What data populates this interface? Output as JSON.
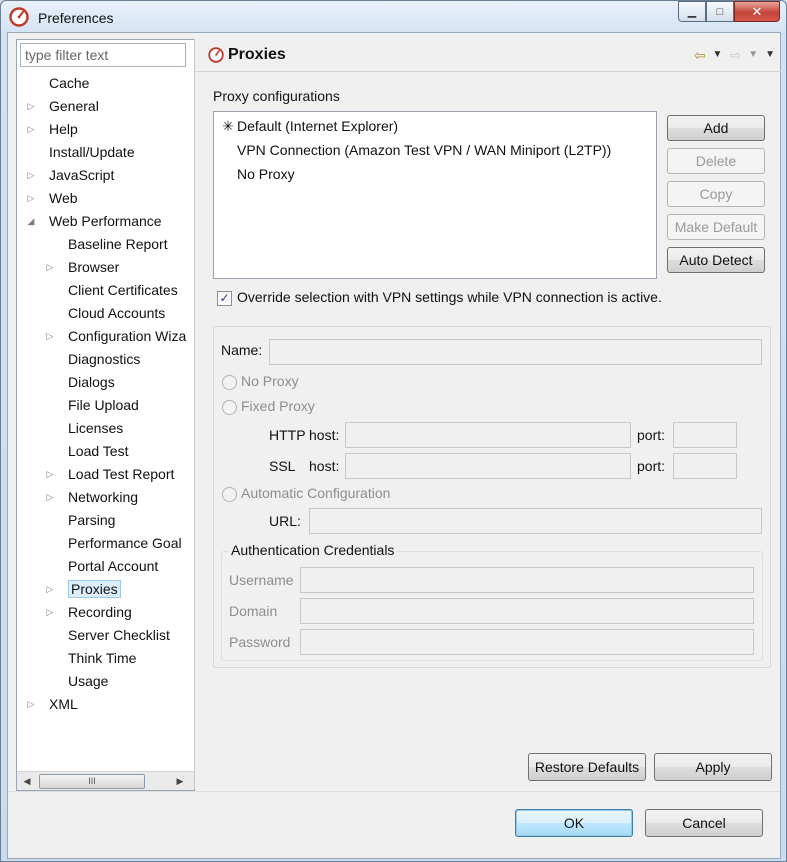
{
  "window": {
    "title": "Preferences",
    "min_glyph": "▁",
    "max_glyph": "□",
    "close_glyph": "✕"
  },
  "filter": {
    "placeholder": "type filter text"
  },
  "tree": [
    {
      "label": "Cache",
      "depth": 0,
      "arrow": ""
    },
    {
      "label": "General",
      "depth": 0,
      "arrow": "▷"
    },
    {
      "label": "Help",
      "depth": 0,
      "arrow": "▷"
    },
    {
      "label": "Install/Update",
      "depth": 0,
      "arrow": ""
    },
    {
      "label": "JavaScript",
      "depth": 0,
      "arrow": "▷"
    },
    {
      "label": "Web",
      "depth": 0,
      "arrow": "▷"
    },
    {
      "label": "Web Performance",
      "depth": 0,
      "arrow": "◢"
    },
    {
      "label": "Baseline Report",
      "depth": 1,
      "arrow": ""
    },
    {
      "label": "Browser",
      "depth": 1,
      "arrow": "▷"
    },
    {
      "label": "Client Certificates",
      "depth": 1,
      "arrow": ""
    },
    {
      "label": "Cloud Accounts",
      "depth": 1,
      "arrow": ""
    },
    {
      "label": "Configuration Wiza",
      "depth": 1,
      "arrow": "▷"
    },
    {
      "label": "Diagnostics",
      "depth": 1,
      "arrow": ""
    },
    {
      "label": "Dialogs",
      "depth": 1,
      "arrow": ""
    },
    {
      "label": "File Upload",
      "depth": 1,
      "arrow": ""
    },
    {
      "label": "Licenses",
      "depth": 1,
      "arrow": ""
    },
    {
      "label": "Load Test",
      "depth": 1,
      "arrow": ""
    },
    {
      "label": "Load Test Report",
      "depth": 1,
      "arrow": "▷"
    },
    {
      "label": "Networking",
      "depth": 1,
      "arrow": "▷"
    },
    {
      "label": "Parsing",
      "depth": 1,
      "arrow": ""
    },
    {
      "label": "Performance Goal",
      "depth": 1,
      "arrow": ""
    },
    {
      "label": "Portal Account",
      "depth": 1,
      "arrow": ""
    },
    {
      "label": "Proxies",
      "depth": 1,
      "arrow": "▷",
      "selected": true
    },
    {
      "label": "Recording",
      "depth": 1,
      "arrow": "▷"
    },
    {
      "label": "Server Checklist",
      "depth": 1,
      "arrow": ""
    },
    {
      "label": "Think Time",
      "depth": 1,
      "arrow": ""
    },
    {
      "label": "Usage",
      "depth": 1,
      "arrow": ""
    },
    {
      "label": "XML",
      "depth": 0,
      "arrow": "▷"
    }
  ],
  "scroll": {
    "left": "◀",
    "right": "▶",
    "thumb": "III"
  },
  "header": {
    "title": "Proxies",
    "back_icon": "⇦",
    "forward_icon": "⇨",
    "dropdown": "▼"
  },
  "proxies": {
    "section_label": "Proxy configurations",
    "items": [
      {
        "star": "✳",
        "label": "Default (Internet Explorer)"
      },
      {
        "star": "",
        "label": "VPN Connection (Amazon Test VPN / WAN Miniport (L2TP))"
      },
      {
        "star": "",
        "label": "No Proxy"
      }
    ],
    "buttons": {
      "add": "Add",
      "delete": "Delete",
      "copy": "Copy",
      "make_default": "Make Default",
      "auto_detect": "Auto Detect"
    },
    "override_checked": "✓",
    "override_label": "Override selection with VPN settings while VPN connection is active."
  },
  "details": {
    "name_label": "Name:",
    "no_proxy": "No Proxy",
    "fixed_proxy": "Fixed Proxy",
    "http_label": "HTTP",
    "ssl_label": "SSL",
    "host_label": "host:",
    "port_label": "port:",
    "auto_config": "Automatic Configuration",
    "url_label": "URL:",
    "auth_title": "Authentication Credentials",
    "username": "Username",
    "domain": "Domain",
    "password": "Password"
  },
  "actions": {
    "restore_defaults": "Restore Defaults",
    "apply": "Apply",
    "ok": "OK",
    "cancel": "Cancel"
  }
}
